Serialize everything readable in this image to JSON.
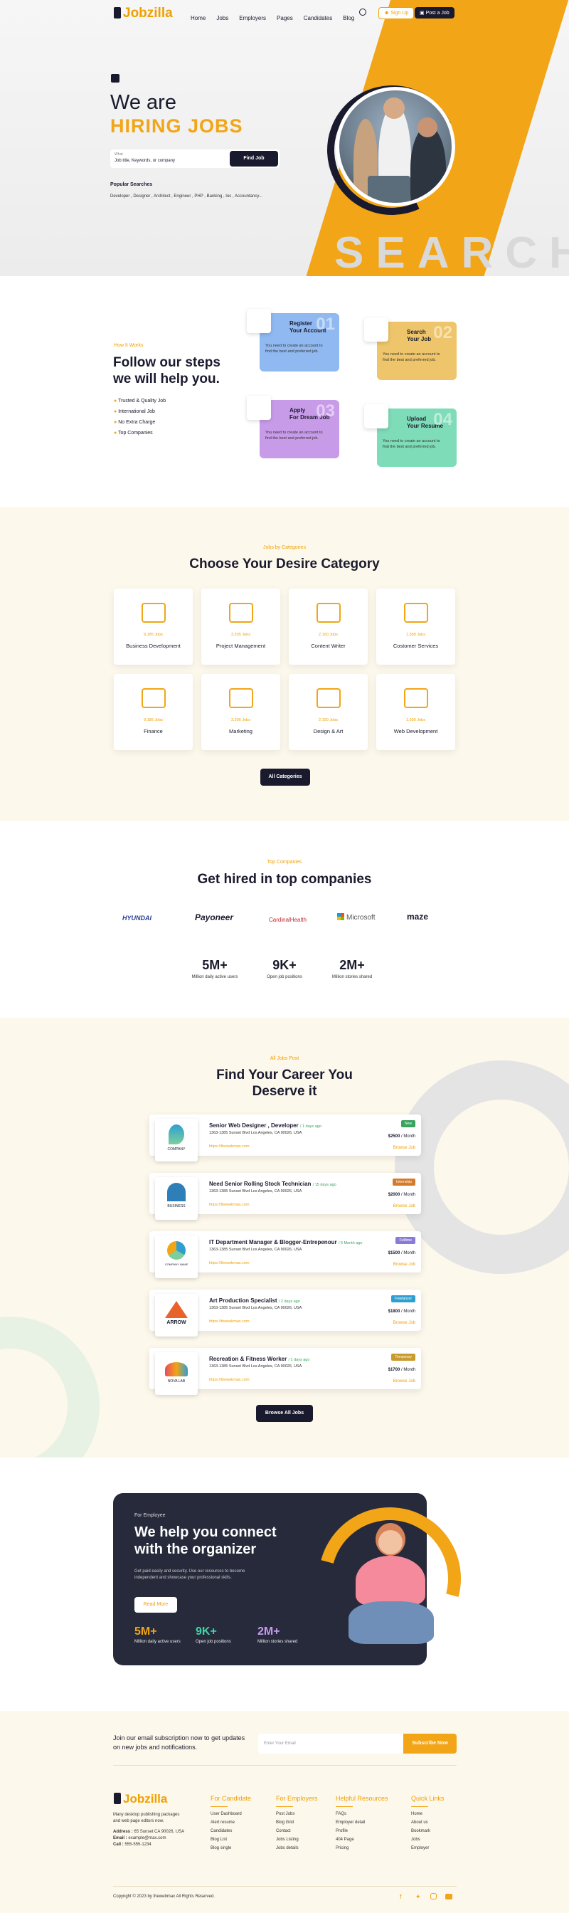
{
  "header": {
    "logo": "Jobzilla",
    "nav": [
      "Home",
      "Jobs",
      "Employers",
      "Pages",
      "Candidates",
      "Blog"
    ],
    "sign_up": "Sign Up",
    "post_job": "Post a Job"
  },
  "hero": {
    "line1": "We are",
    "line2": "HIRING JOBS",
    "search_label": "What",
    "search_placeholder": "Job title, Keywords, or company",
    "find_button": "Find Job",
    "popular_label": "Popular Searches",
    "popular_list": "Developer , Designer , Architect , Engineer , PHP , Banking , Ios , Accountancy...",
    "background_word": "SEARCH"
  },
  "how": {
    "eyebrow": "How It Works",
    "title_line1": "Follow our steps",
    "title_line2": "we will help you.",
    "bullets": [
      "Trusted & Quality Job",
      "International Job",
      "No Extra Charge",
      "Top Companies"
    ],
    "steps": [
      {
        "num": "01",
        "title1": "Register",
        "title2": "Your Account",
        "desc1": "You need to create an account to",
        "desc2": "find the best and preferred job."
      },
      {
        "num": "02",
        "title1": "Search",
        "title2": "Your Job",
        "desc1": "You need to create an account to",
        "desc2": "find the best and preferred job."
      },
      {
        "num": "03",
        "title1": "Apply",
        "title2": "For Dream Job",
        "desc1": "You need to create an account to",
        "desc2": "find the best and preferred job."
      },
      {
        "num": "04",
        "title1": "Upload",
        "title2": "Your Resume",
        "desc1": "You need to create an account to",
        "desc2": "find the best and preferred job."
      }
    ]
  },
  "categories": {
    "eyebrow": "Jobs by Categories",
    "title": "Choose Your Desire Category",
    "items": [
      {
        "count": "9,185 Jobs",
        "name": "Business Development"
      },
      {
        "count": "3,205 Jobs",
        "name": "Project Management"
      },
      {
        "count": "2,100 Jobs",
        "name": "Content Writer"
      },
      {
        "count": "1,500 Jobs",
        "name": "Costomer Services"
      },
      {
        "count": "9,185 Jobs",
        "name": "Finance"
      },
      {
        "count": "3,205 Jobs",
        "name": "Marketing"
      },
      {
        "count": "2,100 Jobs",
        "name": "Design & Art"
      },
      {
        "count": "1,500 Jobs",
        "name": "Web Development"
      }
    ],
    "button": "All Categories"
  },
  "companies": {
    "eyebrow": "Top Companies",
    "title": "Get hired in top companies",
    "logos": [
      "HYUNDAI",
      "Payoneer",
      "CardinalHealth",
      "Microsoft",
      "maze"
    ],
    "stats": [
      {
        "value": "5M+",
        "label": "Million daily active users"
      },
      {
        "value": "9K+",
        "label": "Open job positions"
      },
      {
        "value": "2M+",
        "label": "Million stories shared"
      }
    ]
  },
  "jobs": {
    "eyebrow": "All Jobs Post",
    "title_line1": "Find Your Career You",
    "title_line2": "Deserve it",
    "list": [
      {
        "title": "Senior Web Designer , Developer",
        "ago": "/ 1 days ago",
        "addr": "1363-1385 Sunset Blvd Los Angeles, CA 90026, USA",
        "url": "https://thewebmax.com",
        "tag": "New",
        "tag_color": "#3aa35f",
        "salary": "$2500",
        "period": "/ Month",
        "browse": "Browse Job",
        "logo_text": "COMPANY"
      },
      {
        "title": "Need Senior Rolling Stock Technician",
        "ago": "/ 15 days ago",
        "addr": "1363-1385 Sunset Blvd Los Angeles, CA 90026, USA",
        "url": "https://thewebmax.com",
        "tag": "Internship",
        "tag_color": "#d57a2a",
        "salary": "$2000",
        "period": "/ Month",
        "browse": "Browse Job",
        "logo_text": "BUSINESS"
      },
      {
        "title": "IT Department Manager & Blogger-Entrepenour",
        "ago": "/ 6 Month ago",
        "addr": "1363-1385 Sunset Blvd Los Angeles, CA 90026, USA",
        "url": "https://thewebmax.com",
        "tag": "Fulltime",
        "tag_color": "#8a7ad8",
        "salary": "$1500",
        "period": "/ Month",
        "browse": "Browse Job",
        "logo_text": "COMPANY NAME"
      },
      {
        "title": "Art Production Specialist",
        "ago": "/ 2 days ago",
        "addr": "1363-1385 Sunset Blvd Los Angeles, CA 90026, USA",
        "url": "https://thewebmax.com",
        "tag": "Freelancer",
        "tag_color": "#2f9fd0",
        "salary": "$1800",
        "period": "/ Month",
        "browse": "Browse Job",
        "logo_text": "ARROW"
      },
      {
        "title": "Recreation & Fitness Worker",
        "ago": "/ 1 days ago",
        "addr": "1363-1385 Sunset Blvd Los Angeles, CA 90026, USA",
        "url": "https://thewebmax.com",
        "tag": "Temporary",
        "tag_color": "#c99a2e",
        "salary": "$1700",
        "period": "/ Month",
        "browse": "Browse Job",
        "logo_text": "NOVA LAB"
      }
    ],
    "button": "Browse All Jobs"
  },
  "employee": {
    "eyebrow": "For Employee",
    "title_line1": "We help you connect",
    "title_line2": "with the organizer",
    "desc1": "Get paid easily and security. Use our resources to become",
    "desc2": "independent and showcase your professional skills.",
    "button": "Read More",
    "stats": [
      {
        "value": "5M+",
        "label": "Million daily active users",
        "color": "#f2a516"
      },
      {
        "value": "9K+",
        "label": "Open job positions",
        "color": "#3fd6a6"
      },
      {
        "value": "2M+",
        "label": "Million stories shared",
        "color": "#c79cf0"
      }
    ]
  },
  "newsletter": {
    "text1": "Join our email subscription now to get updates",
    "text2": "on new jobs and notifications.",
    "placeholder": "Enter Your Email",
    "button": "Subscribe Now"
  },
  "footer": {
    "logo": "Jobzilla",
    "about1": "Many desktop publishing packages",
    "about2": "and web page editors now.",
    "address_label": "Address :",
    "address": "65 Sunset CA 90026, USA",
    "email_label": "Email :",
    "email": "example@max.com",
    "call_label": "Call :",
    "call": "555-555-1234",
    "columns": [
      {
        "title": "For Candidate",
        "links": [
          "User Dashboard",
          "Alert resume",
          "Candidates",
          "Blog List",
          "Blog single"
        ]
      },
      {
        "title": "For Employers",
        "links": [
          "Post Jobs",
          "Blog Grid",
          "Contact",
          "Jobs Listing",
          "Jobs details"
        ]
      },
      {
        "title": "Helpful Resources",
        "links": [
          "FAQs",
          "Employer detail",
          "Profile",
          "404 Page",
          "Pricing"
        ]
      },
      {
        "title": "Quick Links",
        "links": [
          "Home",
          "About us",
          "Bookmark",
          "Jobs",
          "Employer"
        ]
      }
    ],
    "copyright": "Copyright © 2023 by thewebmax All Rights Reserved."
  }
}
